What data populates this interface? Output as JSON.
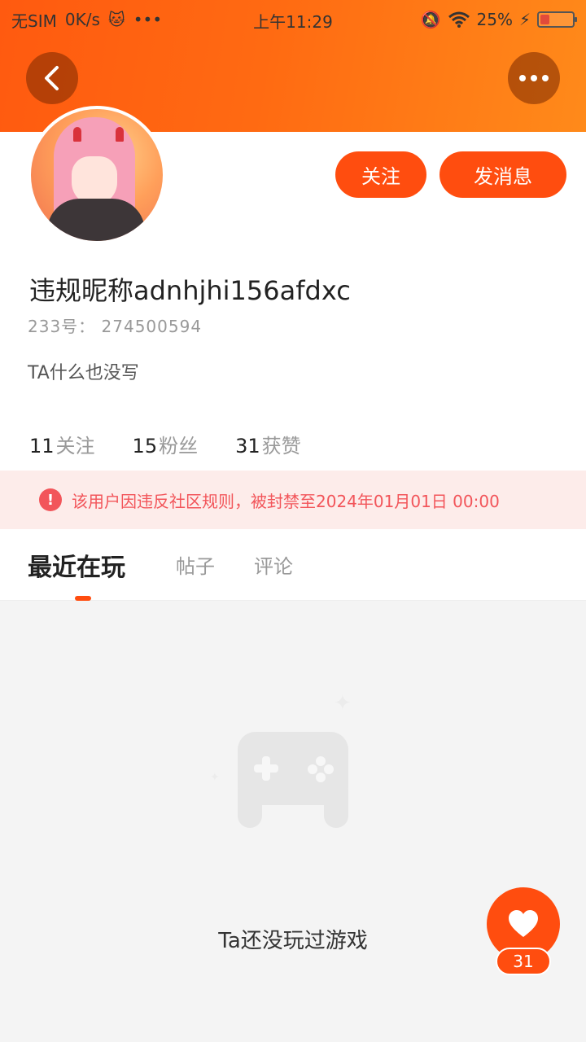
{
  "status_bar": {
    "carrier": "无SIM",
    "speed": "0K/s",
    "time": "上午11:29",
    "battery": "25%",
    "battery_level": 0.25
  },
  "header": {
    "back_icon": "chevron-left-icon",
    "more_icon": "more-horizontal-icon"
  },
  "profile": {
    "follow_label": "关注",
    "message_label": "发消息",
    "nickname": "违规昵称adnhjhi156afdxc",
    "uid": "233号： 274500594",
    "bio": "TA什么也没写",
    "stats": [
      {
        "num": "11",
        "label": "关注"
      },
      {
        "num": "15",
        "label": "粉丝"
      },
      {
        "num": "31",
        "label": "获赞"
      }
    ]
  },
  "ban_notice": {
    "icon": "!",
    "text": "该用户因违反社区规则，被封禁至2024年01月01日 00:00",
    "color": "#f2555a"
  },
  "tabs": [
    {
      "label": "最近在玩",
      "active": true
    },
    {
      "label": "帖子",
      "active": false
    },
    {
      "label": "评论",
      "active": false
    }
  ],
  "empty_state": {
    "icon": "gamepad-icon",
    "text": "Ta还没玩过游戏"
  },
  "like_fab": {
    "icon": "heart-icon",
    "count": "31"
  },
  "colors": {
    "accent": "#ff4d0f",
    "banner_start": "#ff5a10",
    "banner_end": "#ff8a1a"
  }
}
